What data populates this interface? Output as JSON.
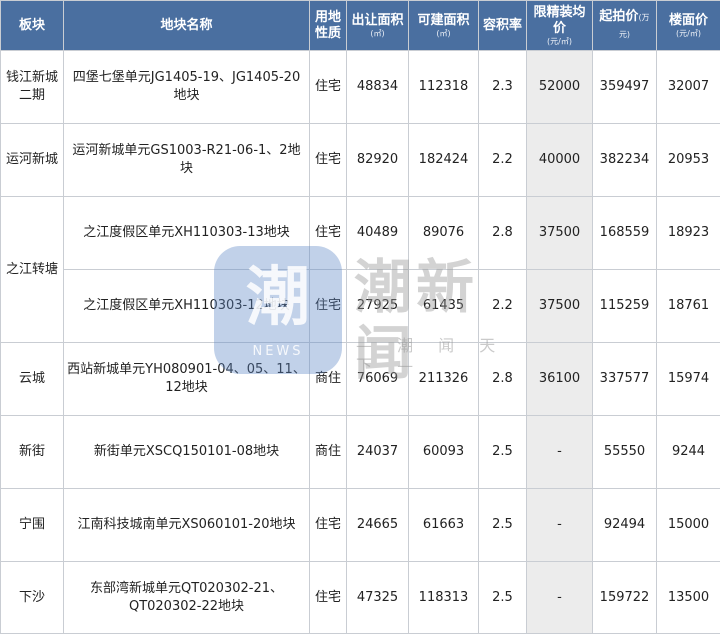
{
  "headers": {
    "block": "板块",
    "plot_name": "地块名称",
    "land_use_l1": "用地",
    "land_use_l2": "性质",
    "transfer_area": "出让面积",
    "transfer_area_unit": "(㎡)",
    "buildable_area": "可建面积",
    "buildable_area_unit": "(㎡)",
    "plot_ratio": "容积率",
    "limit_price": "限精装均价",
    "limit_price_unit": "(元/㎡)",
    "start_price": "起拍价",
    "start_price_unit": "(万元)",
    "floor_price": "楼面价",
    "floor_price_unit": "(元/㎡)"
  },
  "rows": [
    {
      "block": "钱江新城\n二期",
      "name": "四堡七堡单元JG1405-19、JG1405-20\n地块",
      "use": "住宅",
      "area": "48834",
      "build": "112318",
      "ratio": "2.3",
      "limit": "52000",
      "start": "359497",
      "floor": "32007"
    },
    {
      "block": "运河新城",
      "name": "运河新城单元GS1003-R21-06-1、2地块",
      "use": "住宅",
      "area": "82920",
      "build": "182424",
      "ratio": "2.2",
      "limit": "40000",
      "start": "382234",
      "floor": "20953"
    },
    {
      "block": "之江转塘",
      "name": "之江度假区单元XH110303-13地块",
      "use": "住宅",
      "area": "40489",
      "build": "89076",
      "ratio": "2.8",
      "limit": "37500",
      "start": "168559",
      "floor": "18923"
    },
    {
      "block": "",
      "name": "之江度假区单元XH110303-12地块",
      "use": "住宅",
      "area": "27925",
      "build": "61435",
      "ratio": "2.2",
      "limit": "37500",
      "start": "115259",
      "floor": "18761"
    },
    {
      "block": "云城",
      "name": "西站新城单元YH080901-04、05、11、\n12地块",
      "use": "商住",
      "area": "76069",
      "build": "211326",
      "ratio": "2.8",
      "limit": "36100",
      "start": "337577",
      "floor": "15974"
    },
    {
      "block": "新街",
      "name": "新街单元XSCQ150101-08地块",
      "use": "商住",
      "area": "24037",
      "build": "60093",
      "ratio": "2.5",
      "limit": "-",
      "start": "55550",
      "floor": "9244"
    },
    {
      "block": "宁围",
      "name": "江南科技城南单元XS060101-20地块",
      "use": "住宅",
      "area": "24665",
      "build": "61663",
      "ratio": "2.5",
      "limit": "-",
      "start": "92494",
      "floor": "15000"
    },
    {
      "block": "下沙",
      "name": "东部湾新城单元QT020302-21、\nQT020302-22地块",
      "use": "住宅",
      "area": "47325",
      "build": "118313",
      "ratio": "2.5",
      "limit": "-",
      "start": "159722",
      "floor": "13500"
    }
  ],
  "watermark": {
    "logo_glyph": "潮",
    "logo_text": "NEWS",
    "name": "潮新闻",
    "slogan": "— 潮 闻 天 下 —"
  }
}
